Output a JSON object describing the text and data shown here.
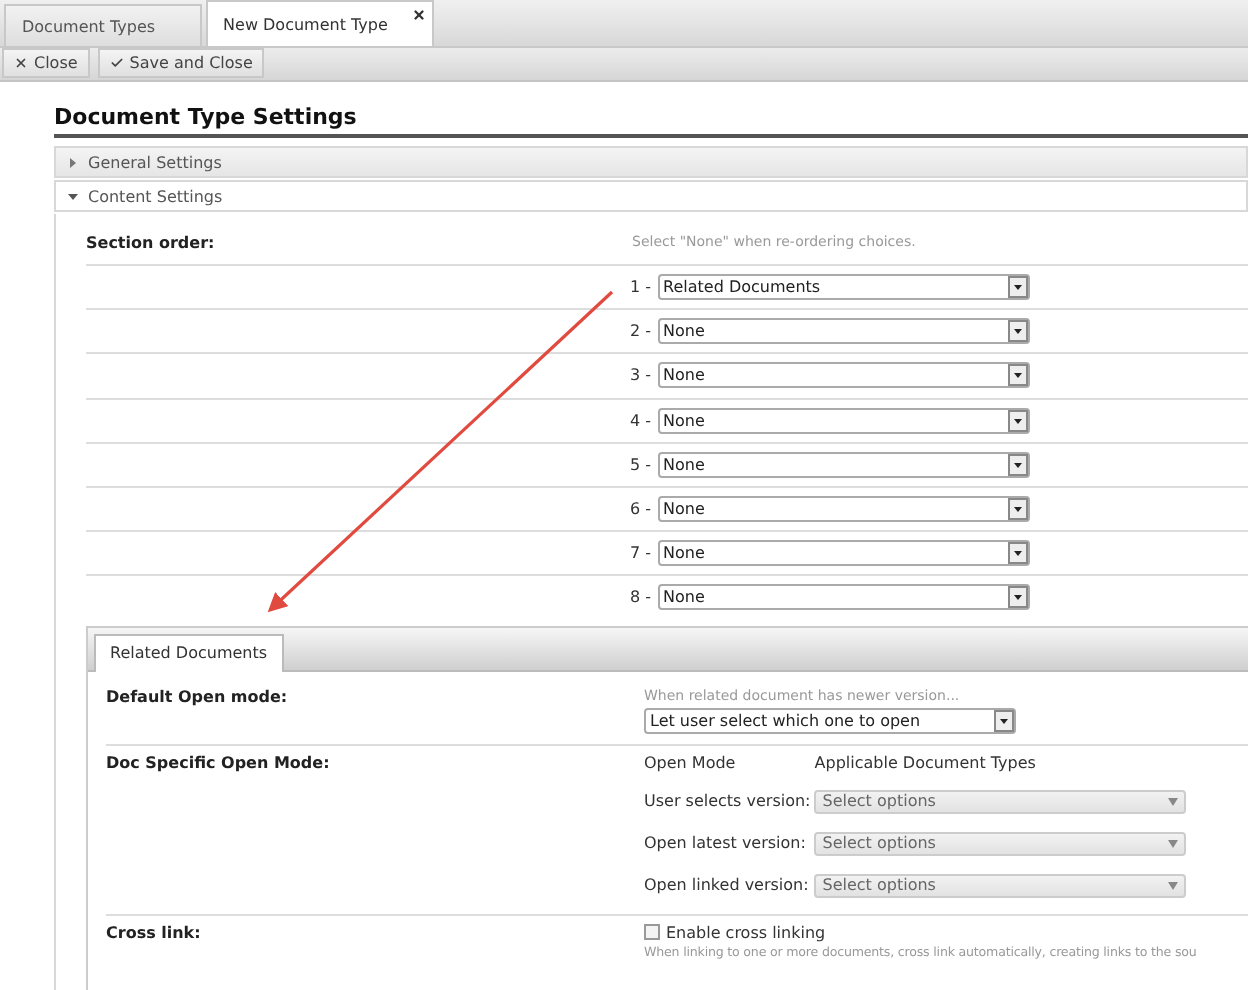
{
  "tabs": [
    {
      "label": "Document Types",
      "selected": false,
      "closable": false
    },
    {
      "label": "New Document Type",
      "selected": true,
      "closable": true
    }
  ],
  "toolbar": [
    {
      "label": "Close"
    },
    {
      "label": "Save and Close"
    }
  ],
  "heading": "Document Type Settings",
  "sections": [
    {
      "label": "General Settings",
      "expanded": false
    },
    {
      "label": "Content Settings",
      "expanded": true
    }
  ],
  "section_order": {
    "label": "Section order:",
    "hint": "Select \"None\" when re-ordering choices.",
    "rows": [
      {
        "number": "1 -",
        "value": "Related Documents"
      },
      {
        "number": "2 -",
        "value": "None"
      },
      {
        "number": "3 -",
        "value": "None"
      },
      {
        "number": "4 -",
        "value": "None"
      },
      {
        "number": "5 -",
        "value": "None"
      },
      {
        "number": "6 -",
        "value": "None"
      },
      {
        "number": "7 -",
        "value": "None"
      },
      {
        "number": "8 -",
        "value": "None"
      }
    ]
  },
  "inner_tabs": [
    {
      "label": "Related Documents",
      "selected": true
    }
  ],
  "default_open_mode": {
    "label": "Default Open mode:",
    "hint": "When related document has newer version...",
    "value": "Let user select which one to open"
  },
  "doc_specific_open_mode": {
    "label": "Doc Specific Open Mode:",
    "columns": [
      "Open Mode",
      "Applicable Document Types"
    ],
    "rows": [
      {
        "label": "User selects version:",
        "placeholder": "Select options"
      },
      {
        "label": "Open latest version:",
        "placeholder": "Select options"
      },
      {
        "label": "Open linked version:",
        "placeholder": "Select options"
      }
    ]
  },
  "cross_link": {
    "label": "Cross link:",
    "checkbox_label": "Enable cross linking",
    "checked": false,
    "description": "When linking to one or more documents, cross link automatically, creating links to the sou"
  }
}
